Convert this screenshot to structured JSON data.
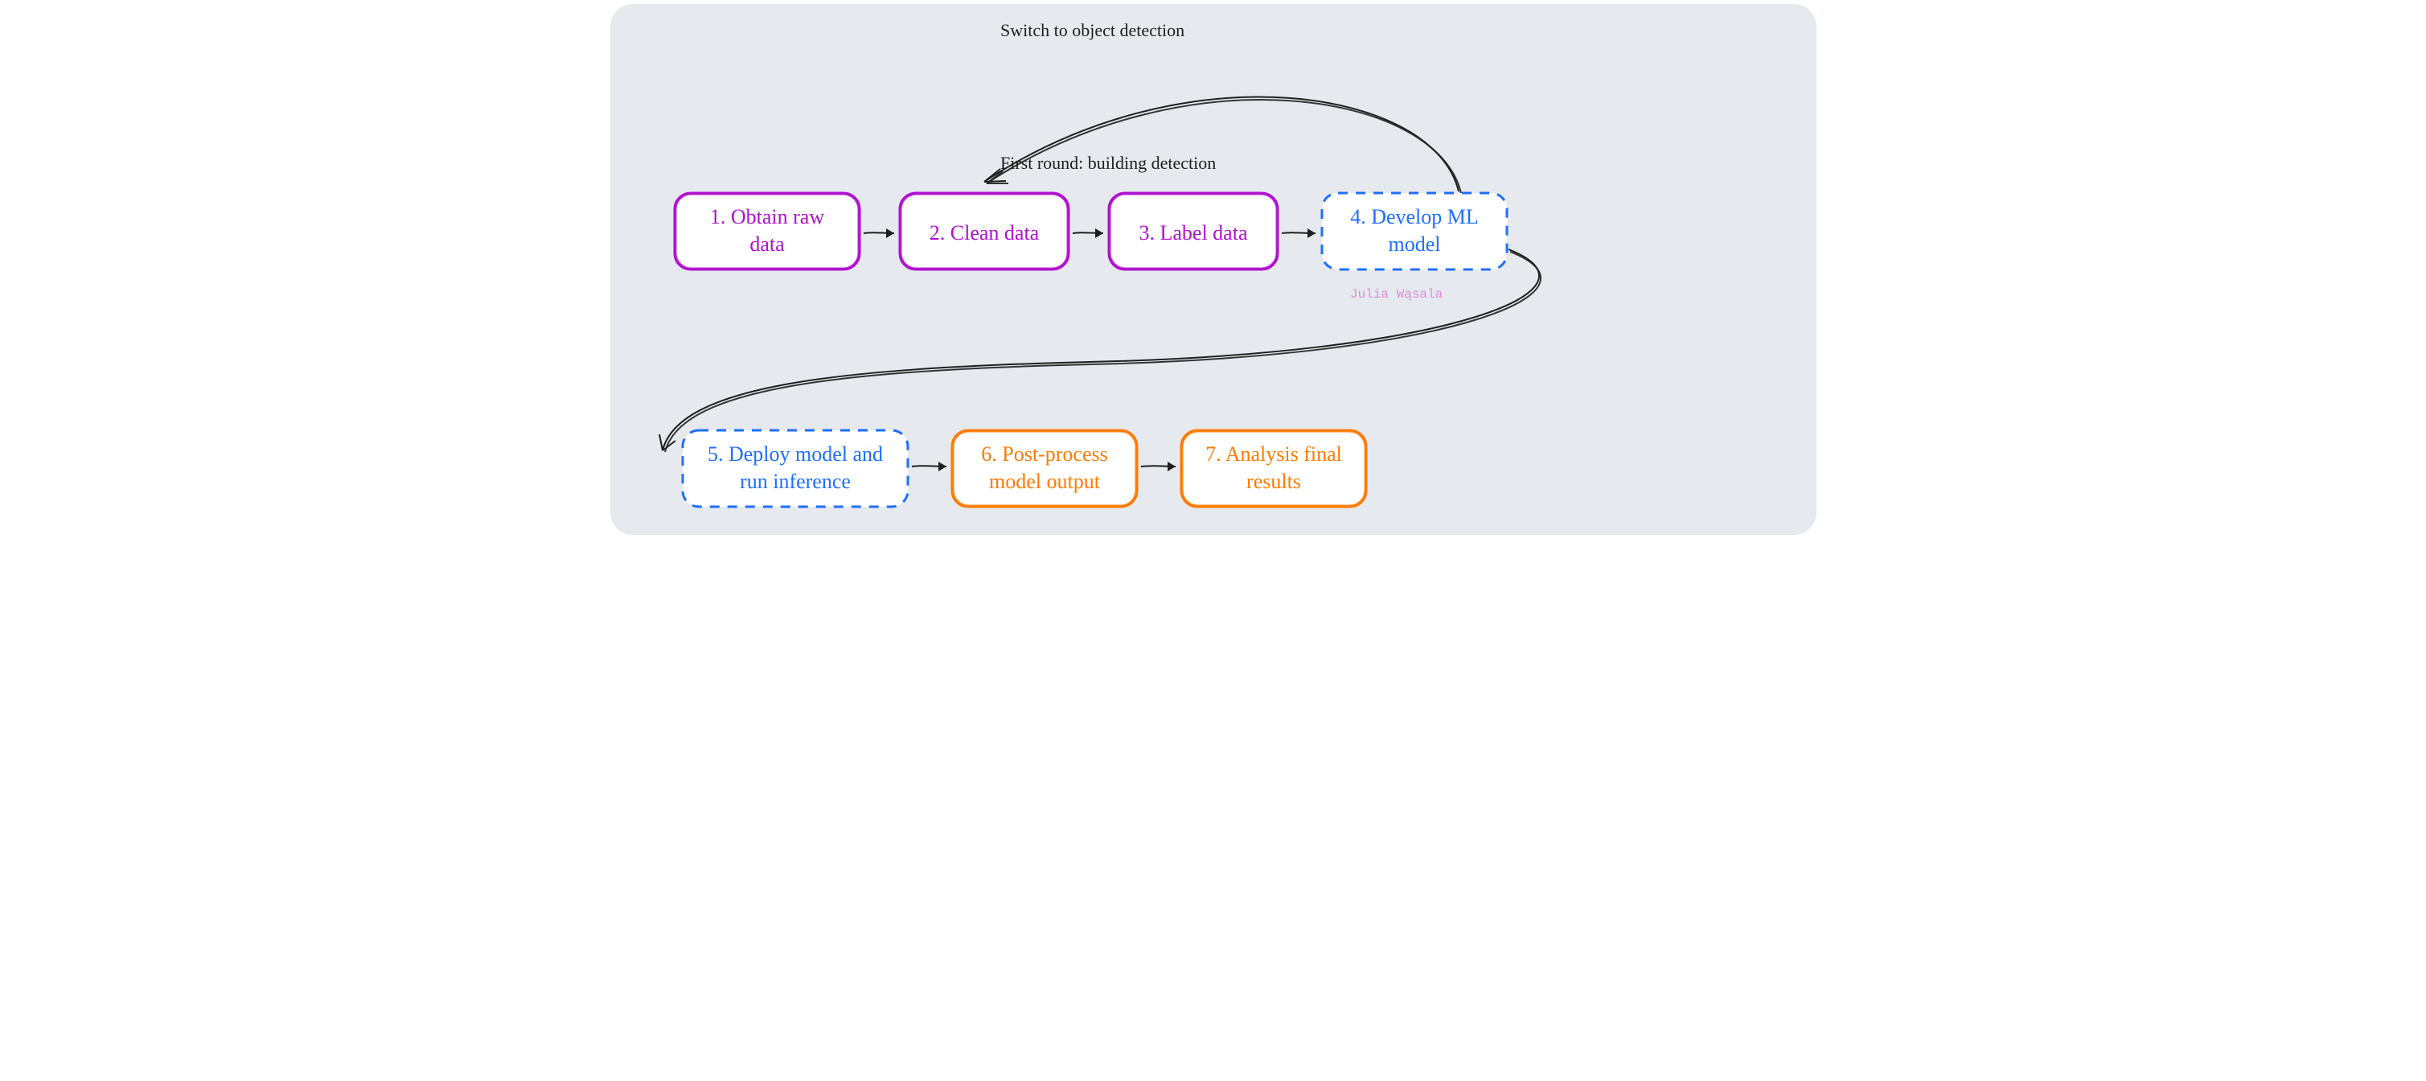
{
  "annotations": {
    "feedback": "Switch to object detection",
    "first_round": "First round: building detection",
    "watermark": "Julia Wąsala"
  },
  "nodes": {
    "n1": {
      "lines": [
        "1. Obtain raw",
        "data"
      ]
    },
    "n2": {
      "lines": [
        "2. Clean data"
      ]
    },
    "n3": {
      "lines": [
        "3. Label data"
      ]
    },
    "n4": {
      "lines": [
        "4. Develop ML",
        "model"
      ]
    },
    "n5": {
      "lines": [
        "5. Deploy model and",
        "run inference"
      ]
    },
    "n6": {
      "lines": [
        "6. Post-process",
        "model output"
      ]
    },
    "n7": {
      "lines": [
        "7. Analysis final",
        "results"
      ]
    }
  },
  "colors": {
    "purple": "#b010d0",
    "blue": "#1e6fff",
    "orange": "#ff7a00",
    "ink": "#1f1f1f",
    "bg": "#e6e9ed"
  }
}
